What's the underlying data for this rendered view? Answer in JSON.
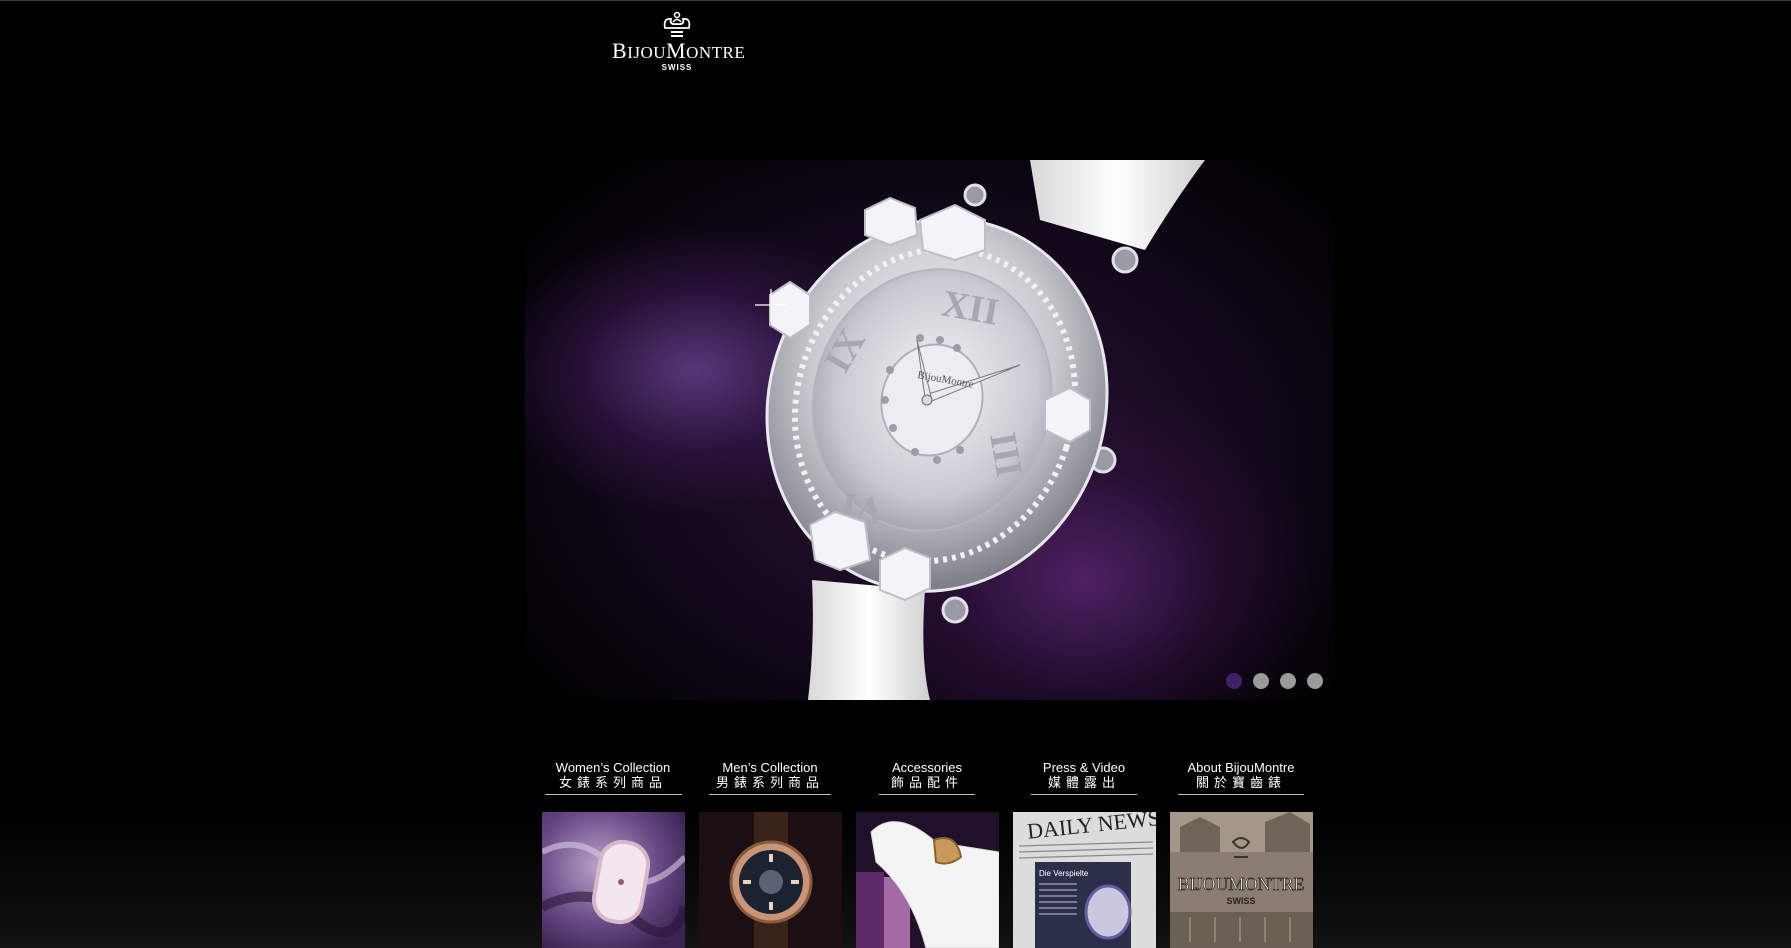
{
  "logo": {
    "brand_small_prefix": "Bijou",
    "brand_initial_1": "B",
    "brand_rest_1": "IJOU",
    "brand_initial_2": "M",
    "brand_rest_2": "ONTRE",
    "tagline": "SWISS"
  },
  "hero": {
    "slide_count": 4,
    "active_slide": 1,
    "watch_logo_text": "BijouMontre"
  },
  "nav_tiles": [
    {
      "en": "Women’s Collection",
      "zh": "女錶系列商品"
    },
    {
      "en": "Men’s Collection",
      "zh": "男錶系列商品"
    },
    {
      "en": "Accessories",
      "zh": "飾品配件"
    },
    {
      "en": "Press & Video",
      "zh": "媒體露出"
    },
    {
      "en": "About BijouMontre",
      "zh": "關於寶齒錶"
    }
  ],
  "thumbs": {
    "press_headline": "DAILY NEWS",
    "press_sub": "Die Verspielte",
    "about_brand": "BIJOUMONTRE",
    "about_tagline": "SWISS"
  },
  "colors": {
    "background": "#000000",
    "dot_active": "#3e2066",
    "dot_inactive": "#9a9a9a",
    "accent_purple": "#5a2a7a"
  }
}
